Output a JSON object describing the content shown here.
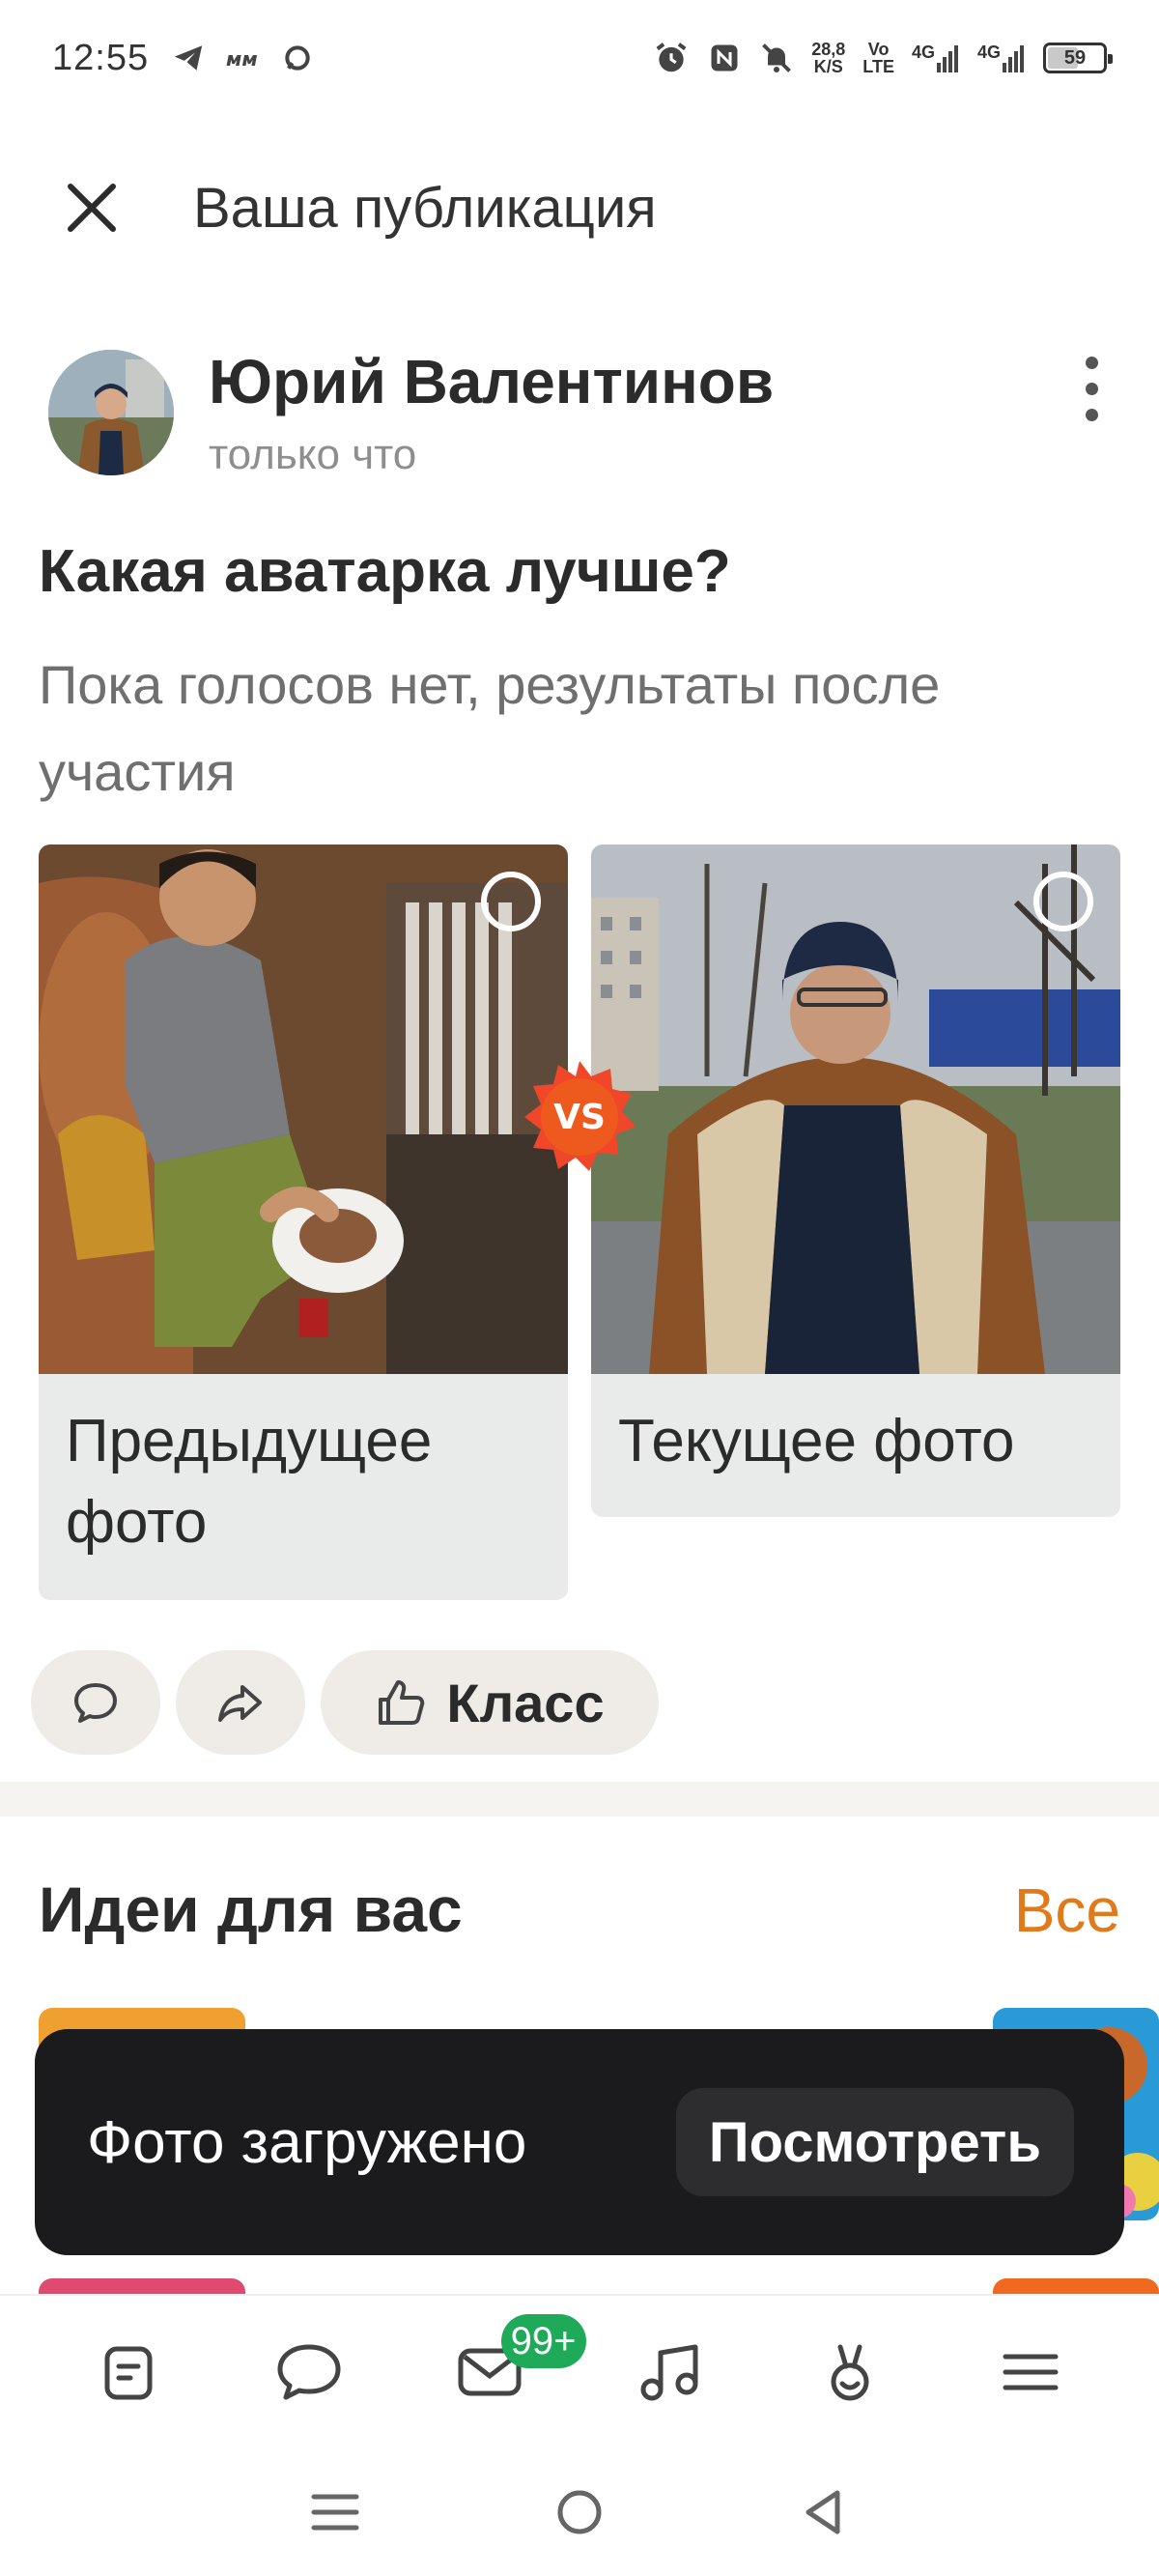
{
  "status_bar": {
    "time": "12:55",
    "speed_value": "28,8",
    "speed_unit": "K/S",
    "volte_top": "Vo",
    "volte_bottom": "LTE",
    "net1": "4G",
    "net2": "4G",
    "battery": "59",
    "battery_level": 0.59
  },
  "header": {
    "title": "Ваша публикация"
  },
  "post": {
    "author_name": "Юрий Валентинов",
    "time": "только что",
    "poll_title": "Какая аватарка лучше?",
    "poll_subtitle": "Пока голосов нет, результаты после участия",
    "options": [
      {
        "label": "Предыдущее фото"
      },
      {
        "label": "Текущее фото"
      }
    ],
    "vs_label": "VS",
    "like_label": "Класс"
  },
  "ideas": {
    "title": "Идеи для вас",
    "all_label": "Все"
  },
  "toast": {
    "text": "Фото загружено",
    "action": "Посмотреть"
  },
  "bottom_nav": {
    "messages_badge": "99+",
    "items": [
      "feed-icon",
      "chat-icon",
      "notifications-icon",
      "music-icon",
      "gifts-icon",
      "menu-icon"
    ]
  },
  "colors": {
    "accent": "#e07a1b",
    "badge": "#1faa5a",
    "toast_bg": "#1b1b1d"
  }
}
